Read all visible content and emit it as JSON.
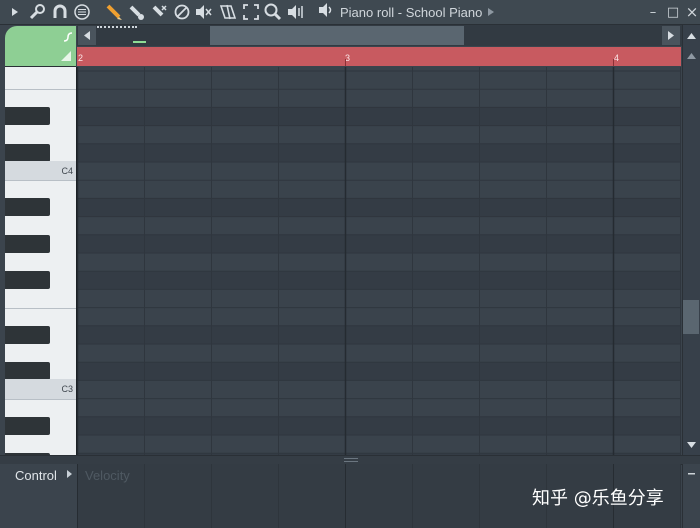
{
  "toolbar": {
    "title": "Piano roll - School Piano",
    "icons": [
      "play-arrow-icon",
      "wrench-icon",
      "magnet-icon",
      "menu-icon",
      "pencil-icon",
      "paint-icon",
      "delete-icon",
      "mute-icon",
      "speaker-mute-icon",
      "slice-icon",
      "select-icon",
      "zoom-icon",
      "playback-icon",
      "audio-icon"
    ],
    "close": "×",
    "maximize": "□",
    "minimize": "–"
  },
  "timeline": {
    "bars": [
      "2",
      "3",
      "4"
    ]
  },
  "keyboard": {
    "labels": [
      "C4",
      "C3"
    ]
  },
  "event_editor": {
    "control_label": "Control",
    "parameter_label": "Velocity"
  },
  "colors": {
    "timeline": "#c85a60",
    "tool_corner": "#8ecf94",
    "grid_bg": "#3a434c"
  },
  "watermark": "知乎 @乐鱼分享"
}
